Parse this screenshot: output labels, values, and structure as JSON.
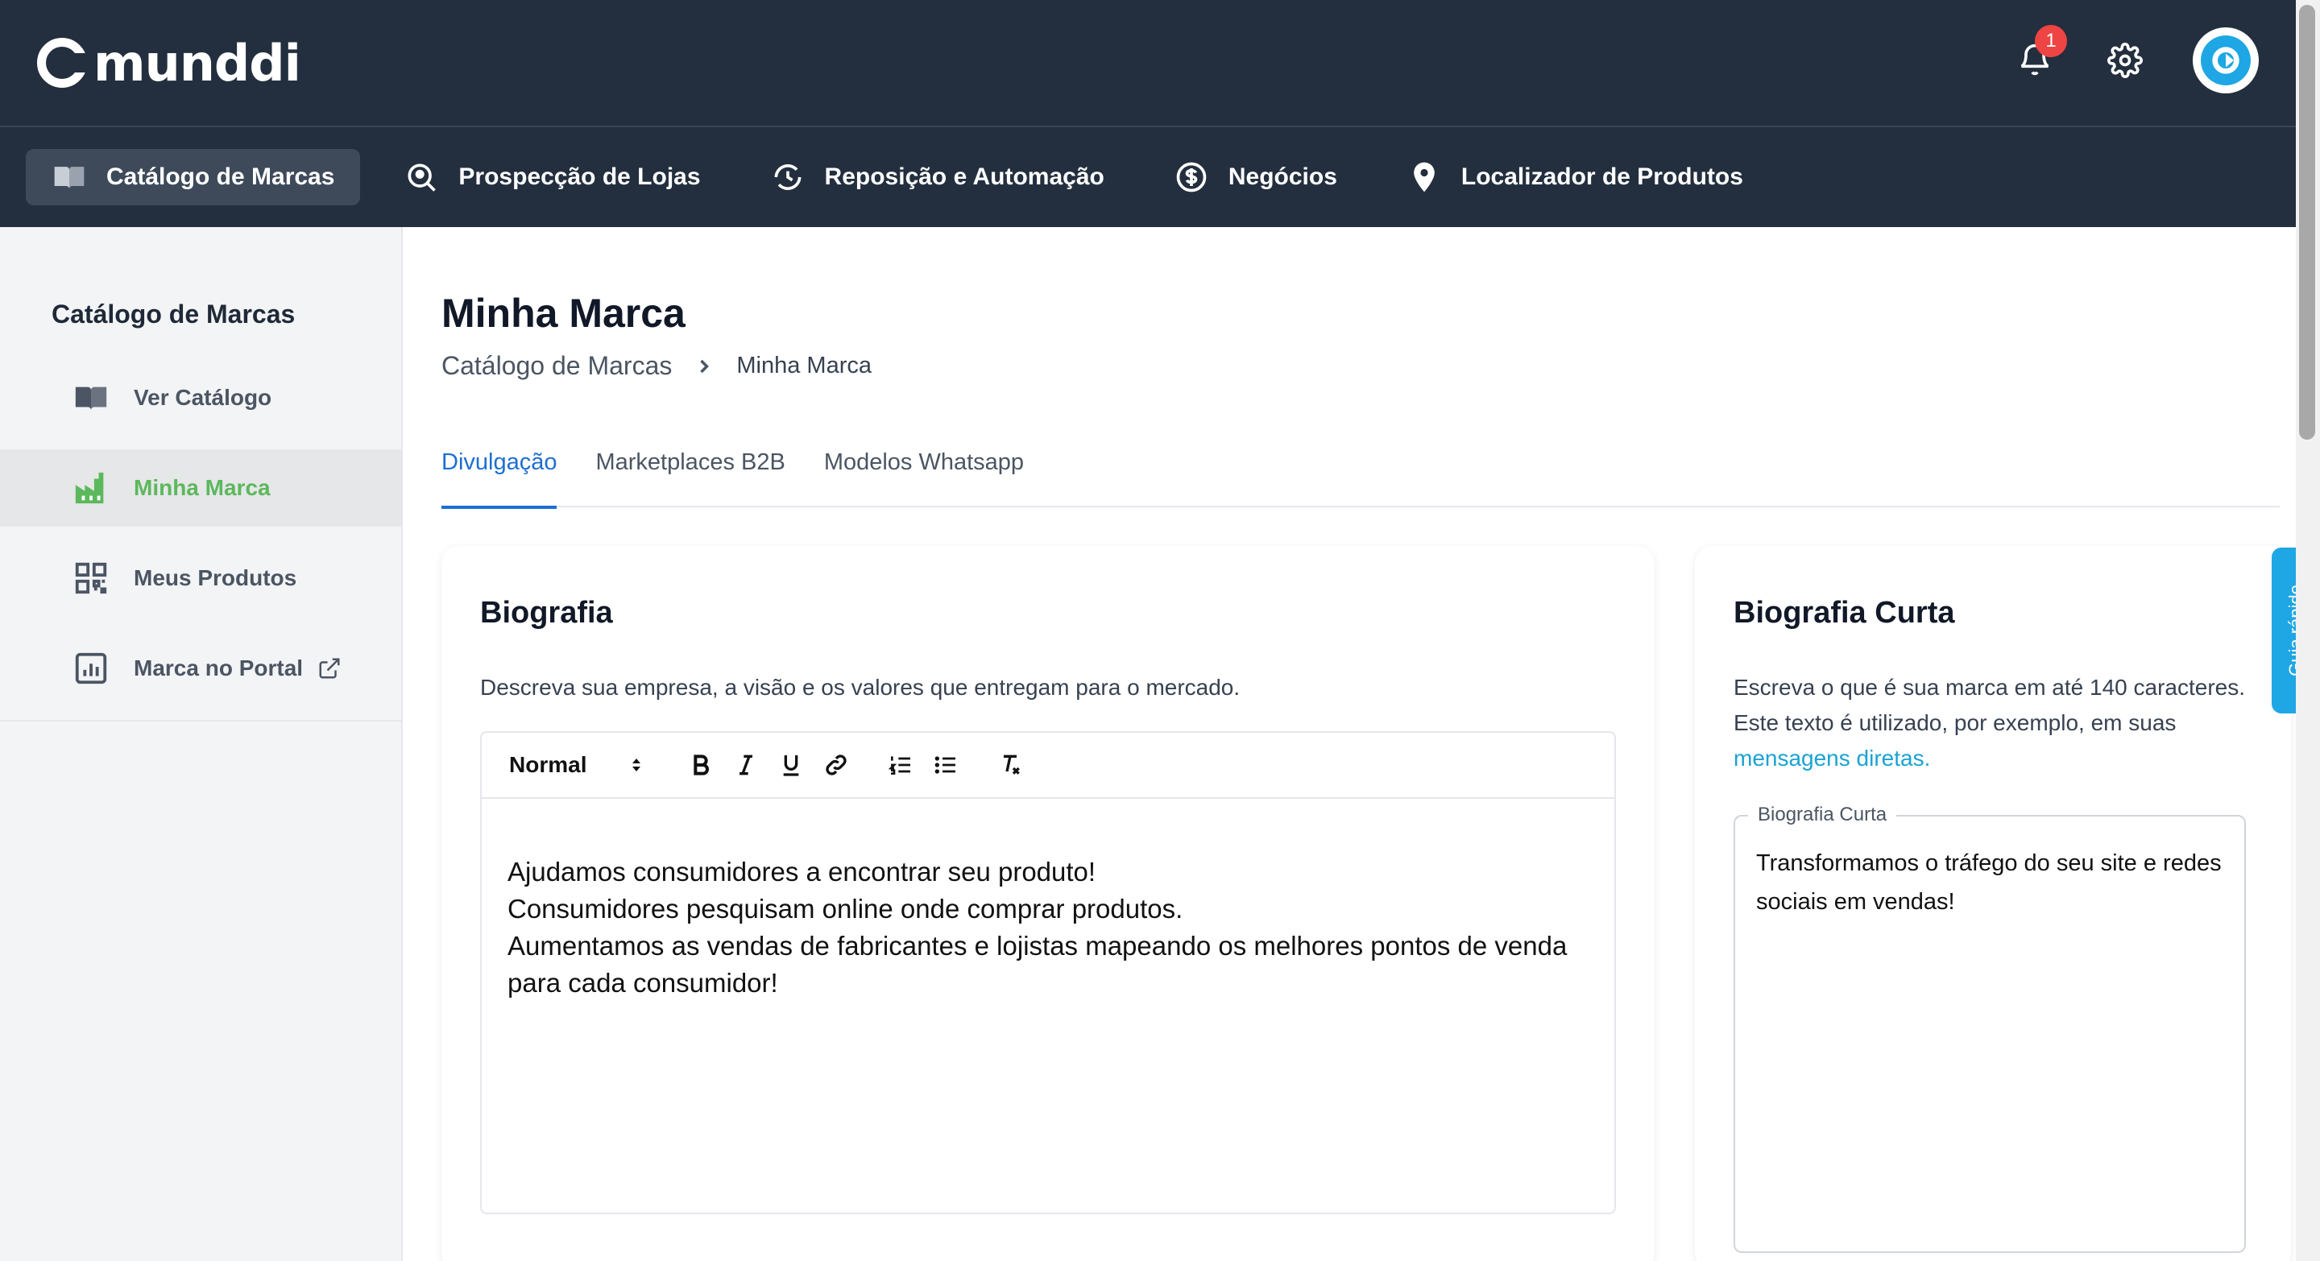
{
  "header": {
    "logo_text": "munddi",
    "notification_count": "1",
    "icons": [
      "bell-icon",
      "gear-icon",
      "avatar"
    ]
  },
  "nav": {
    "items": [
      {
        "label": "Catálogo de Marcas",
        "icon": "book-icon",
        "active": true
      },
      {
        "label": "Prospecção de Lojas",
        "icon": "search-location-icon"
      },
      {
        "label": "Reposição e Automação",
        "icon": "sync-icon"
      },
      {
        "label": "Negócios",
        "icon": "dollar-icon"
      },
      {
        "label": "Localizador de Produtos",
        "icon": "map-pin-icon"
      }
    ]
  },
  "sidebar": {
    "title": "Catálogo de Marcas",
    "items": [
      {
        "label": "Ver Catálogo",
        "icon": "book-icon"
      },
      {
        "label": "Minha Marca",
        "icon": "factory-icon",
        "active": true
      },
      {
        "label": "Meus Produtos",
        "icon": "qr-code-icon"
      },
      {
        "label": "Marca no Portal",
        "icon": "chart-icon"
      }
    ]
  },
  "main": {
    "title": "Minha Marca",
    "breadcrumb": [
      "Catálogo de Marcas",
      "Minha Marca"
    ],
    "tabs": [
      {
        "label": "Divulgação",
        "active": true
      },
      {
        "label": "Marketplaces B2B"
      },
      {
        "label": "Modelos Whatsapp"
      }
    ]
  },
  "bio_card": {
    "title": "Biografia",
    "description": "Descreva sua empresa, a visão e os valores que entregam para o mercado.",
    "format_select": "Normal",
    "content_lines": [
      "Ajudamos consumidores a encontrar seu produto!",
      "Consumidores pesquisam online onde comprar produtos.",
      "Aumentamos as vendas de fabricantes e lojistas mapeando os melhores pontos de venda para cada consumidor!"
    ]
  },
  "short_bio_card": {
    "title": "Biografia Curta",
    "description_prefix": "Escreva o que é sua marca em até 140 caracteres. Este texto é utilizado, por exemplo, em suas ",
    "description_link": "mensagens diretas.",
    "field_label": "Biografia Curta",
    "field_value": "Transformamos o tráfego do seu site e redes sociais em vendas!"
  },
  "quick_guide": {
    "label": "Guia rápido"
  },
  "colors": {
    "header_bg": "#232f3e",
    "accent_blue": "#1d6fd1",
    "active_green": "#5cb85c",
    "link_blue": "#1aa3d3",
    "badge_red": "#ef4444"
  }
}
